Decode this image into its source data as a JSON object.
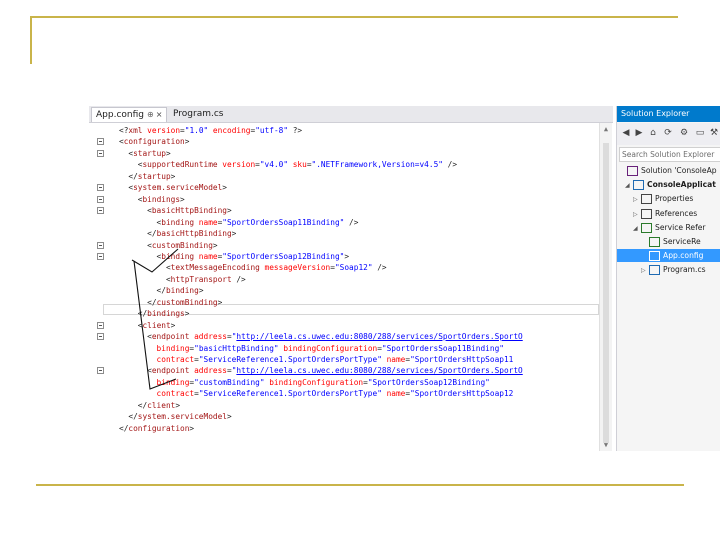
{
  "editor": {
    "tabs": [
      {
        "label": "App.config",
        "pin": "⊕",
        "close": "×"
      },
      {
        "label": "Program.cs"
      }
    ],
    "lines": [
      [
        [
          "<?",
          "br"
        ],
        [
          "xml",
          "tag"
        ],
        [
          " version",
          "att"
        ],
        [
          "=",
          "br"
        ],
        [
          "\"1.0\"",
          "val"
        ],
        [
          " encoding",
          "att"
        ],
        [
          "=",
          "br"
        ],
        [
          "\"utf-8\"",
          "val"
        ],
        [
          " ?>",
          "br"
        ]
      ],
      [
        [
          "<",
          "br"
        ],
        [
          "configuration",
          "tag"
        ],
        [
          ">",
          "br"
        ]
      ],
      [
        [
          "  <",
          "br"
        ],
        [
          "startup",
          "tag"
        ],
        [
          ">",
          "br"
        ]
      ],
      [
        [
          "    <",
          "br"
        ],
        [
          "supportedRuntime",
          "tag"
        ],
        [
          " version",
          "att"
        ],
        [
          "=",
          "br"
        ],
        [
          "\"v4.0\"",
          "val"
        ],
        [
          " sku",
          "att"
        ],
        [
          "=",
          "br"
        ],
        [
          "\".NETFramework,Version=v4.5\"",
          "val"
        ],
        [
          " />",
          "br"
        ]
      ],
      [
        [
          "  </",
          "br"
        ],
        [
          "startup",
          "tag"
        ],
        [
          ">",
          "br"
        ]
      ],
      [
        [
          "  <",
          "br"
        ],
        [
          "system.serviceModel",
          "tag"
        ],
        [
          ">",
          "br"
        ]
      ],
      [
        [
          "    <",
          "br"
        ],
        [
          "bindings",
          "tag"
        ],
        [
          ">",
          "br"
        ]
      ],
      [
        [
          "      <",
          "br"
        ],
        [
          "basicHttpBinding",
          "tag"
        ],
        [
          ">",
          "br"
        ]
      ],
      [
        [
          "        <",
          "br"
        ],
        [
          "binding",
          "tag"
        ],
        [
          " name",
          "att"
        ],
        [
          "=",
          "br"
        ],
        [
          "\"SportOrdersSoap11Binding\"",
          "val"
        ],
        [
          " />",
          "br"
        ]
      ],
      [
        [
          "      </",
          "br"
        ],
        [
          "basicHttpBinding",
          "tag"
        ],
        [
          ">",
          "br"
        ]
      ],
      [
        [
          "      <",
          "br"
        ],
        [
          "customBinding",
          "tag"
        ],
        [
          ">",
          "br"
        ]
      ],
      [
        [
          "        <",
          "br"
        ],
        [
          "binding",
          "tag"
        ],
        [
          " name",
          "att"
        ],
        [
          "=",
          "br"
        ],
        [
          "\"SportOrdersSoap12Binding\"",
          "val"
        ],
        [
          ">",
          "br"
        ]
      ],
      [
        [
          "          <",
          "br"
        ],
        [
          "textMessageEncoding",
          "tag"
        ],
        [
          " messageVersion",
          "att"
        ],
        [
          "=",
          "br"
        ],
        [
          "\"Soap12\"",
          "val"
        ],
        [
          " />",
          "br"
        ]
      ],
      [
        [
          "          <",
          "br"
        ],
        [
          "httpTransport",
          "tag"
        ],
        [
          " />",
          "br"
        ]
      ],
      [
        [
          "        </",
          "br"
        ],
        [
          "binding",
          "tag"
        ],
        [
          ">",
          "br"
        ]
      ],
      [
        [
          "      </",
          "br"
        ],
        [
          "customBinding",
          "tag"
        ],
        [
          ">",
          "br"
        ]
      ],
      [
        [
          "    </",
          "br"
        ],
        [
          "bindings",
          "tag"
        ],
        [
          ">",
          "br"
        ]
      ],
      [
        [
          "    <",
          "br"
        ],
        [
          "client",
          "tag"
        ],
        [
          ">",
          "br"
        ]
      ],
      [
        [
          "      <",
          "br"
        ],
        [
          "endpoint",
          "tag"
        ],
        [
          " address",
          "att"
        ],
        [
          "=",
          "br"
        ],
        [
          "\"",
          "val"
        ],
        [
          "http://leela.cs.uwec.edu:8080/288/services/SportOrders.SportO",
          "url"
        ]
      ],
      [
        [
          "        binding",
          "att"
        ],
        [
          "=",
          "br"
        ],
        [
          "\"basicHttpBinding\"",
          "val"
        ],
        [
          " bindingConfiguration",
          "att"
        ],
        [
          "=",
          "br"
        ],
        [
          "\"SportOrdersSoap11Binding\"",
          "val"
        ]
      ],
      [
        [
          "        contract",
          "att"
        ],
        [
          "=",
          "br"
        ],
        [
          "\"ServiceReference1.SportOrdersPortType\"",
          "val"
        ],
        [
          " name",
          "att"
        ],
        [
          "=",
          "br"
        ],
        [
          "\"SportOrdersHttpSoap11",
          "val"
        ]
      ],
      [
        [
          "      <",
          "br"
        ],
        [
          "endpoint",
          "tag"
        ],
        [
          " address",
          "att"
        ],
        [
          "=",
          "br"
        ],
        [
          "\"",
          "val"
        ],
        [
          "http://leela.cs.uwec.edu:8080/288/services/SportOrders.SportO",
          "url"
        ]
      ],
      [
        [
          "        binding",
          "att"
        ],
        [
          "=",
          "br"
        ],
        [
          "\"customBinding\"",
          "val"
        ],
        [
          " bindingConfiguration",
          "att"
        ],
        [
          "=",
          "br"
        ],
        [
          "\"SportOrdersSoap12Binding\"",
          "val"
        ]
      ],
      [
        [
          "        contract",
          "att"
        ],
        [
          "=",
          "br"
        ],
        [
          "\"ServiceReference1.SportOrdersPortType\"",
          "val"
        ],
        [
          " name",
          "att"
        ],
        [
          "=",
          "br"
        ],
        [
          "\"SportOrdersHttpSoap12",
          "val"
        ]
      ],
      [
        [
          "    </",
          "br"
        ],
        [
          "client",
          "tag"
        ],
        [
          ">",
          "br"
        ]
      ],
      [
        [
          "  </",
          "br"
        ],
        [
          "system.serviceModel",
          "tag"
        ],
        [
          ">",
          "br"
        ]
      ],
      [
        [
          "</",
          "br"
        ],
        [
          "configuration",
          "tag"
        ],
        [
          ">",
          "br"
        ]
      ]
    ]
  },
  "solution_explorer": {
    "title": "Solution Explorer",
    "search_placeholder": "Search Solution Explorer",
    "items": [
      {
        "label": "Solution 'ConsoleAp",
        "arrow": "",
        "bold": false,
        "selected": false
      },
      {
        "label": "ConsoleApplicat",
        "arrow": "◢",
        "bold": true,
        "selected": false
      },
      {
        "label": "Properties",
        "arrow": "▷",
        "bold": false,
        "selected": false
      },
      {
        "label": "References",
        "arrow": "▷",
        "bold": false,
        "selected": false
      },
      {
        "label": "Service Refer",
        "arrow": "◢",
        "bold": false,
        "selected": false
      },
      {
        "label": "ServiceRe",
        "arrow": "",
        "bold": false,
        "selected": false
      },
      {
        "label": "App.config",
        "arrow": "",
        "bold": false,
        "selected": true
      },
      {
        "label": "Program.cs",
        "arrow": "▷",
        "bold": false,
        "selected": false
      }
    ]
  }
}
